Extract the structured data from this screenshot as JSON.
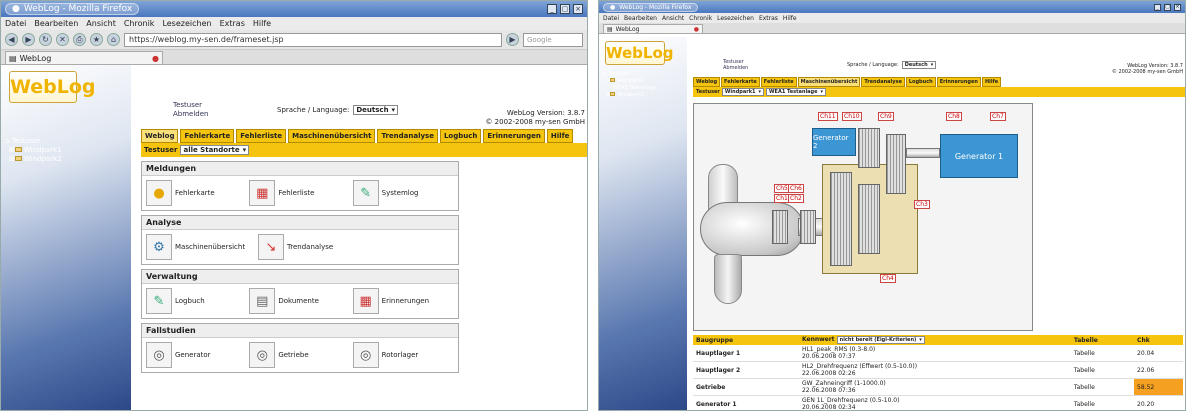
{
  "window1": {
    "title": "WebLog - Mozilla Firefox",
    "menu": [
      "Datei",
      "Bearbeiten",
      "Ansicht",
      "Chronik",
      "Lesezeichen",
      "Extras",
      "Hilfe"
    ],
    "url": "https://weblog.my-sen.de/frameset.jsp",
    "search_placeholder": "Google",
    "tab_title": "WebLog",
    "logo": "WebLog",
    "user": "Testuser",
    "logout": "Abmelden",
    "lang_label": "Sprache / Language:",
    "lang_value": "Deutsch",
    "version": "WebLog Version: 3.8.7",
    "copyright": "© 2002-2008 my-sen GmbH",
    "tree": [
      "Testuser",
      "Windpark1",
      "Windpark2"
    ],
    "tabs": [
      "Weblog",
      "Fehlerkarte",
      "Fehlerliste",
      "Maschinenübersicht",
      "Trendanalyse",
      "Logbuch",
      "Erinnerungen",
      "Hilfe"
    ],
    "filter_label": "Testuser",
    "filter_value": "alle Standorte",
    "panels": [
      {
        "title": "Meldungen",
        "items": [
          {
            "label": "Fehlerkarte",
            "icon": "map-icon"
          },
          {
            "label": "Fehlerliste",
            "icon": "list-icon"
          },
          {
            "label": "Systemlog",
            "icon": "log-icon"
          }
        ]
      },
      {
        "title": "Analyse",
        "items": [
          {
            "label": "Maschinenübersicht",
            "icon": "machine-icon"
          },
          {
            "label": "Trendanalyse",
            "icon": "trend-icon"
          }
        ]
      },
      {
        "title": "Verwaltung",
        "items": [
          {
            "label": "Logbuch",
            "icon": "book-icon"
          },
          {
            "label": "Dokumente",
            "icon": "document-icon"
          },
          {
            "label": "Erinnerungen",
            "icon": "reminder-icon"
          }
        ]
      },
      {
        "title": "Fallstudien",
        "items": [
          {
            "label": "Generator",
            "icon": "generator-icon"
          },
          {
            "label": "Getriebe",
            "icon": "gearbox-icon"
          },
          {
            "label": "Rotorlager",
            "icon": "bearing-icon"
          }
        ]
      }
    ]
  },
  "window2": {
    "title": "WebLog - Mozilla Firefox",
    "menu": [
      "Datei",
      "Bearbeiten",
      "Ansicht",
      "Chronik",
      "Lesezeichen",
      "Extras",
      "Hilfe"
    ],
    "tab_title": "WebLog",
    "logo": "WebLog",
    "user": "Testuser",
    "logout": "Abmelden",
    "lang_label": "Sprache / Language:",
    "lang_value": "Deutsch",
    "version": "WebLog Version: 3.8.7",
    "copyright": "© 2002-2008 my-sen GmbH",
    "tree": [
      "Testuser",
      "Windpark1",
      "WEA1 Testanlage",
      "Windpark2"
    ],
    "tabs": [
      "Weblog",
      "Fehlerkarte",
      "Fehlerliste",
      "Maschinenübersicht",
      "Trendanalyse",
      "Logbuch",
      "Erinnerungen",
      "Hilfe"
    ],
    "filter_label": "Testuser",
    "filter_value1": "Windpark1",
    "filter_value2": "WEA1 Testanlage",
    "gen1": "Generator 1",
    "gen2": "Generator 2",
    "labels": [
      "Ch11",
      "Ch10",
      "Ch9",
      "Ch8",
      "Ch7",
      "Ch5",
      "Ch6",
      "Ch3",
      "Ch4",
      "Ch1",
      "Ch2"
    ],
    "table_headers": [
      "Baugruppe",
      "Kennwert",
      "Tabelle",
      "Chk"
    ],
    "table_select": "nicht bereit (Eigl-Kriterien)",
    "rows": [
      {
        "group": "Hauptlager 1",
        "value": "HL1_peak_RMS (0.3-8.0)",
        "date": "20.06.2008 07:37",
        "status": "Tabelle",
        "num": "20.04"
      },
      {
        "group": "Hauptlager 2",
        "value": "HL2_Drehfrequenz (Effwert (0.5-10.0))",
        "date": "22.06.2008 02:26",
        "status": "Tabelle",
        "num": "22.06"
      },
      {
        "group": "Getriebe",
        "value": "GW_Zahneingriff (1-1000.0)",
        "date": "22.06.2008 07:36",
        "status": "Tabelle",
        "num": "58.52"
      },
      {
        "group": "Generator 1",
        "value": "GEN 1L_Drehfrequenz (0.5-10.0)",
        "date": "20.06.2008 02:34",
        "status": "Tabelle",
        "num": "20.20"
      }
    ]
  }
}
